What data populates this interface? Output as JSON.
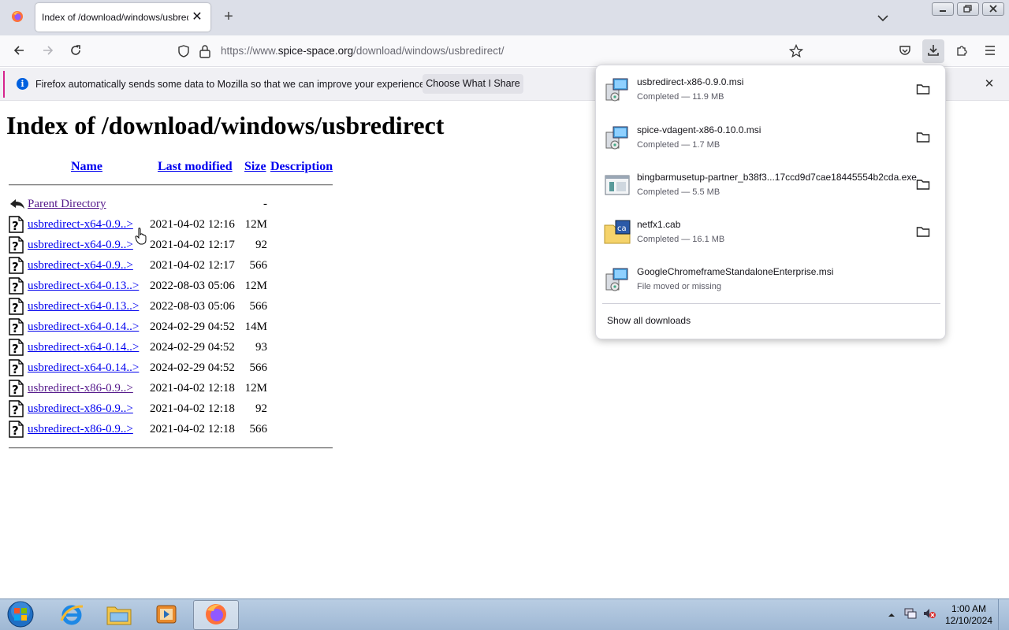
{
  "browser": {
    "tab": {
      "title": "Index of /download/windows/usbredirect/"
    },
    "url": {
      "prefix": "https://www.",
      "domain": "spice-space.org",
      "path": "/download/windows/usbredirect/"
    },
    "icons": [
      "firefox-icon",
      "back-icon",
      "forward-icon",
      "reload-icon",
      "shield-icon",
      "lock-icon",
      "star-icon",
      "pocket-icon",
      "download-icon",
      "extensions-icon",
      "menu-icon"
    ]
  },
  "notification": {
    "text": "Firefox automatically sends some data to Mozilla so that we can improve your experience.",
    "button": "Choose What I Share"
  },
  "page": {
    "title": "Index of /download/windows/usbredirect",
    "headers": {
      "name": "Name",
      "modified": "Last modified",
      "size": "Size",
      "description": "Description"
    },
    "parent": {
      "label": "Parent Directory",
      "size": "-"
    },
    "rows": [
      {
        "name": "usbredirect-x64-0.9..>",
        "modified": "2021-04-02 12:16",
        "size": "12M",
        "visited": false
      },
      {
        "name": "usbredirect-x64-0.9..>",
        "modified": "2021-04-02 12:17",
        "size": "92",
        "visited": false
      },
      {
        "name": "usbredirect-x64-0.9..>",
        "modified": "2021-04-02 12:17",
        "size": "566",
        "visited": false
      },
      {
        "name": "usbredirect-x64-0.13..>",
        "modified": "2022-08-03 05:06",
        "size": "12M",
        "visited": false
      },
      {
        "name": "usbredirect-x64-0.13..>",
        "modified": "2022-08-03 05:06",
        "size": "566",
        "visited": false
      },
      {
        "name": "usbredirect-x64-0.14..>",
        "modified": "2024-02-29 04:52",
        "size": "14M",
        "visited": false
      },
      {
        "name": "usbredirect-x64-0.14..>",
        "modified": "2024-02-29 04:52",
        "size": "93",
        "visited": false
      },
      {
        "name": "usbredirect-x64-0.14..>",
        "modified": "2024-02-29 04:52",
        "size": "566",
        "visited": false
      },
      {
        "name": "usbredirect-x86-0.9..>",
        "modified": "2021-04-02 12:18",
        "size": "12M",
        "visited": true
      },
      {
        "name": "usbredirect-x86-0.9..>",
        "modified": "2021-04-02 12:18",
        "size": "92",
        "visited": false
      },
      {
        "name": "usbredirect-x86-0.9..>",
        "modified": "2021-04-02 12:18",
        "size": "566",
        "visited": false
      }
    ]
  },
  "downloads": {
    "items": [
      {
        "name": "usbredirect-x86-0.9.0.msi",
        "status": "Completed — 11.9 MB",
        "icon": "msi-installer-icon"
      },
      {
        "name": "spice-vdagent-x86-0.10.0.msi",
        "status": "Completed — 1.7 MB",
        "icon": "msi-installer-icon"
      },
      {
        "name": "bingbarmusetup-partner_b38f3...17ccd9d7cae18445554b2cda.exe",
        "status": "Completed — 5.5 MB",
        "icon": "exe-app-icon"
      },
      {
        "name": "netfx1.cab",
        "status": "Completed — 16.1 MB",
        "icon": "cab-archive-icon"
      },
      {
        "name": "GoogleChromeframeStandaloneEnterprise.msi",
        "status": "File moved or missing",
        "icon": "msi-installer-icon"
      }
    ],
    "show_all": "Show all downloads"
  },
  "taskbar": {
    "time": "1:00 AM",
    "date": "12/10/2024",
    "apps": [
      "start-orb-icon",
      "internet-explorer-icon",
      "file-explorer-icon",
      "media-player-icon",
      "firefox-icon"
    ]
  }
}
